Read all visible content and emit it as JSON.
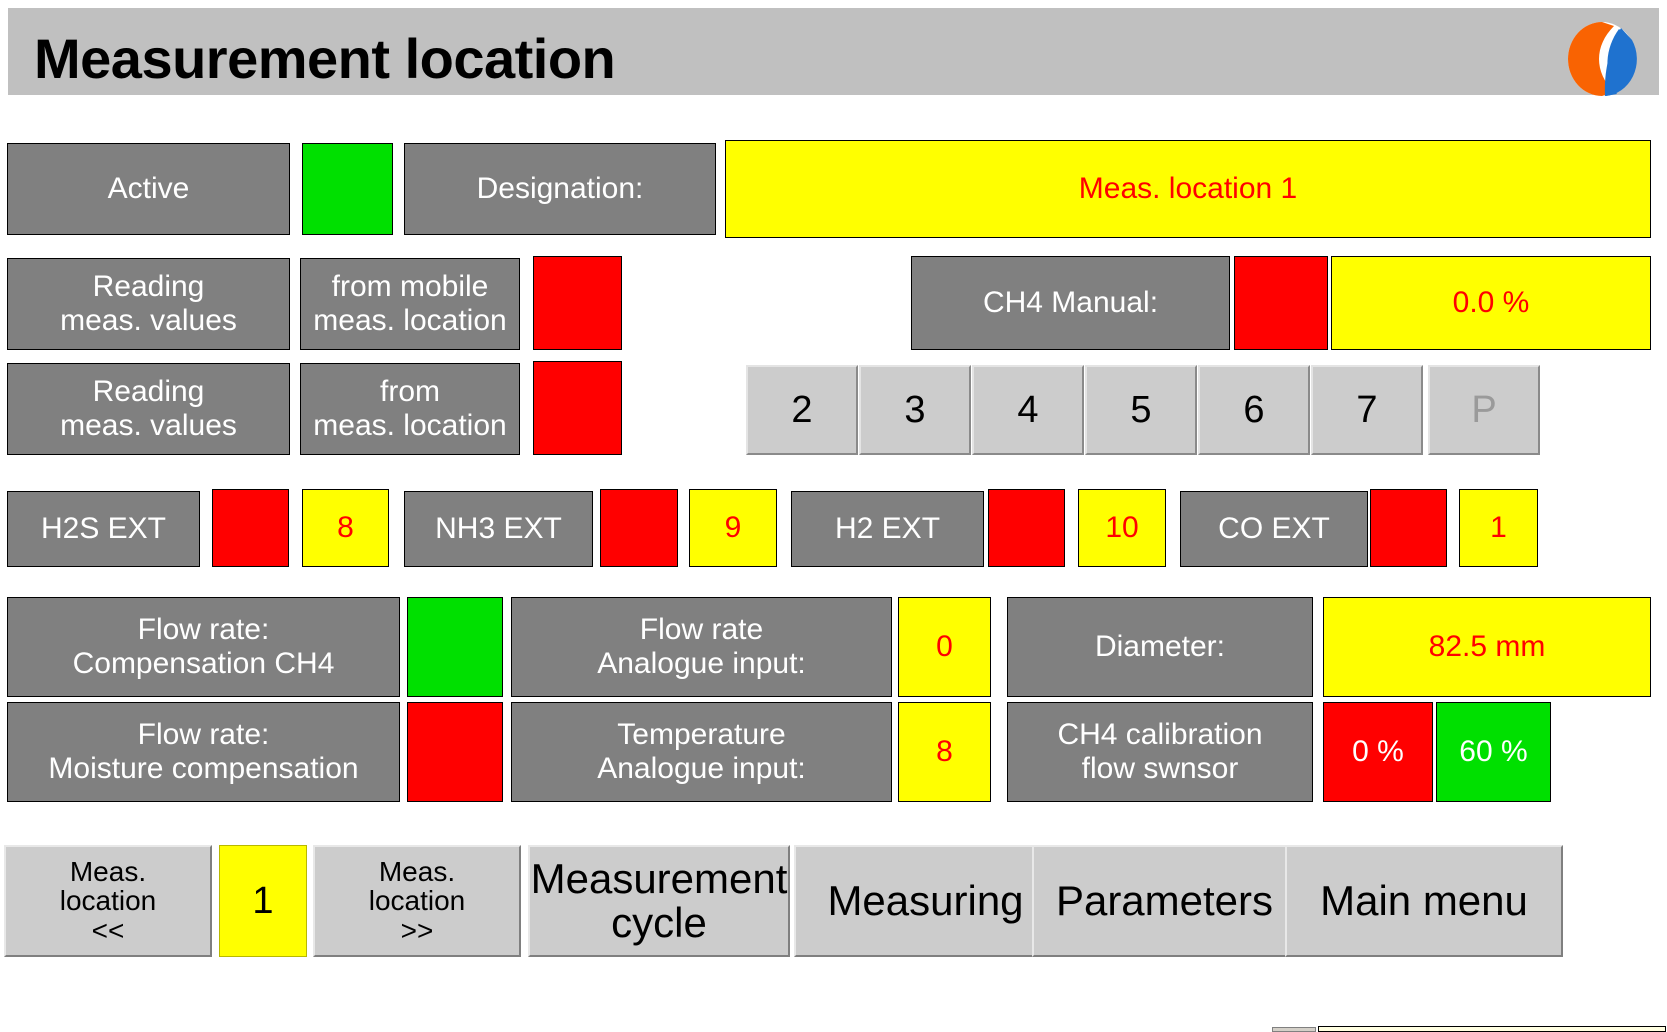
{
  "header": {
    "title": "Measurement location",
    "logo_name": "company-logo",
    "logo_colors": {
      "left": "#f96302",
      "right": "#1f72cf"
    }
  },
  "colors": {
    "gray_button": "#808080",
    "status_green": "#00e000",
    "status_red": "#ff0000",
    "value_yellow": "#ffff00",
    "value_text_red": "#ff0000",
    "keypad_gray": "#cccccc",
    "titlebar_gray": "#c0c0c0"
  },
  "row_active": {
    "active_label": "Active",
    "active_status": "green",
    "designation_label": "Designation:",
    "designation_value": "Meas. location 1"
  },
  "row_reading_mobile": {
    "label_left": "Reading\nmeas. values",
    "label_right": "from mobile\nmeas. location",
    "status": "red"
  },
  "row_reading_fixed": {
    "label_left": "Reading\nmeas. values",
    "label_right": "from\nmeas. location",
    "status": "red"
  },
  "ch4_manual": {
    "label": "CH4 Manual:",
    "status": "red",
    "value": "0.0 %"
  },
  "keypad": {
    "keys": [
      {
        "label": "2",
        "disabled": false
      },
      {
        "label": "3",
        "disabled": false
      },
      {
        "label": "4",
        "disabled": false
      },
      {
        "label": "5",
        "disabled": false
      },
      {
        "label": "6",
        "disabled": false
      },
      {
        "label": "7",
        "disabled": false
      },
      {
        "label": "P",
        "disabled": true
      }
    ]
  },
  "sensors": [
    {
      "label": "H2S EXT",
      "status": "red",
      "value": "8"
    },
    {
      "label": "NH3 EXT",
      "status": "red",
      "value": "9"
    },
    {
      "label": "H2 EXT",
      "status": "red",
      "value": "10"
    },
    {
      "label": "CO EXT",
      "status": "red",
      "value": "1"
    }
  ],
  "flow_row_1": {
    "label": "Flow rate:\nCompensation CH4",
    "status": "green",
    "analogue_label": "Flow rate\nAnalogue input:",
    "analogue_value": "0",
    "diameter_label": "Diameter:",
    "diameter_value": "82.5 mm"
  },
  "flow_row_2": {
    "label": "Flow rate:\nMoisture compensation",
    "status": "red",
    "analogue_label": "Temperature\nAnalogue input:",
    "analogue_value": "8",
    "calibration_label": "CH4 calibration\nflow swnsor",
    "calibration_low": "0 %",
    "calibration_high": "60 %"
  },
  "toolbar": {
    "prev_label": "Meas.\nlocation\n<<",
    "location_number": "1",
    "next_label": "Meas.\nlocation\n>>",
    "cycle_label": "Measurement\ncycle",
    "measuring_label": "Measuring",
    "parameters_label": "Parameters",
    "main_menu_label": "Main menu"
  }
}
